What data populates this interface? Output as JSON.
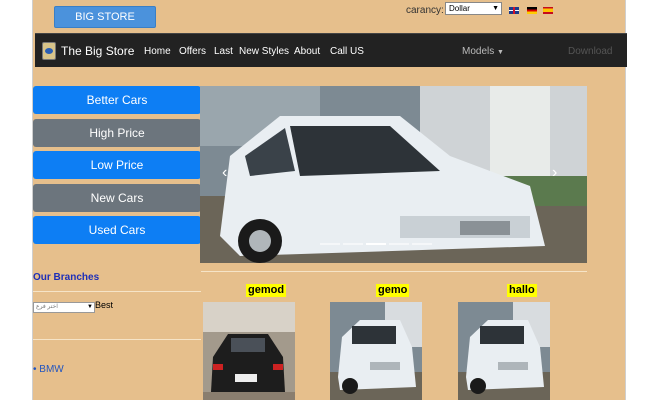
{
  "header": {
    "brand_button": "BIG STORE",
    "currency_label": "carancy:",
    "currency_value": "Dollar",
    "language_flags": [
      "english-flag",
      "german-flag",
      "spanish-flag"
    ]
  },
  "navbar": {
    "title": "The Big Store",
    "items": [
      "Home",
      "Offers",
      "Last",
      "New Styles",
      "About",
      "Call US"
    ],
    "models_label": "Models",
    "download_label": "Download"
  },
  "sidebar": {
    "buttons": [
      {
        "label": "Better Cars",
        "style": "primary"
      },
      {
        "label": "High Price",
        "style": "secondary"
      },
      {
        "label": "Low Price",
        "style": "primary"
      },
      {
        "label": "New Cars",
        "style": "secondary"
      },
      {
        "label": "Used Cars",
        "style": "primary"
      }
    ],
    "branches_title": "Our Branches",
    "branch_select_value": "اختر فرع",
    "best_label": "Best",
    "brands": [
      "BMW"
    ]
  },
  "carousel": {
    "prev_icon": "chevron-left-icon",
    "next_icon": "chevron-right-icon",
    "slide_count": 5,
    "active_slide": 2
  },
  "products": [
    {
      "label": "gemod"
    },
    {
      "label": "gemo"
    },
    {
      "label": "hallo"
    }
  ],
  "colors": {
    "page_background": "#e6bf8c",
    "navbar": "#222222",
    "primary": "#0d7ef4",
    "secondary": "#6c757d",
    "label_highlight": "#ffff00",
    "branches_title": "#1e2fb8"
  }
}
